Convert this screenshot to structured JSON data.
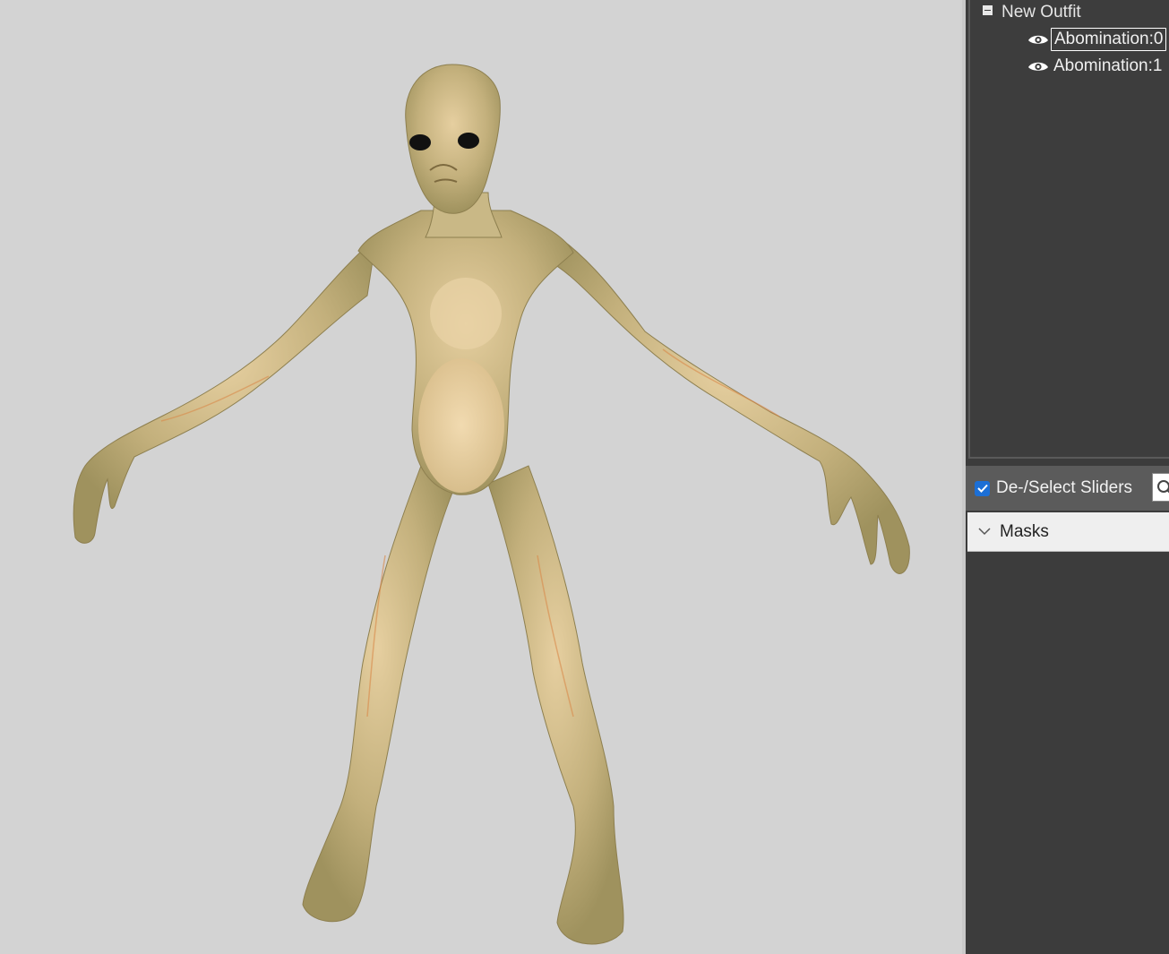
{
  "outfit_tree": {
    "root_label": "New Outfit",
    "children": [
      {
        "label": "Abomination:0",
        "visible": true,
        "selected": true
      },
      {
        "label": "Abomination:1",
        "visible": true,
        "selected": false
      }
    ]
  },
  "slider_toolbar": {
    "select_label": "De-/Select Sliders",
    "checked": true
  },
  "slider_groups": [
    {
      "label": "Masks",
      "expanded": false
    }
  ],
  "icons": {
    "collapse": "collapse-minus-icon",
    "visibility": "eye-icon",
    "checkbox": "checkmark-icon",
    "search": "search-icon",
    "chevron": "chevron-down-icon"
  },
  "colors": {
    "viewport_bg": "#d3d3d3",
    "panel_bg": "#3d3d3d",
    "accent": "#1c6fd6",
    "model_skin": "#c9b98a"
  }
}
